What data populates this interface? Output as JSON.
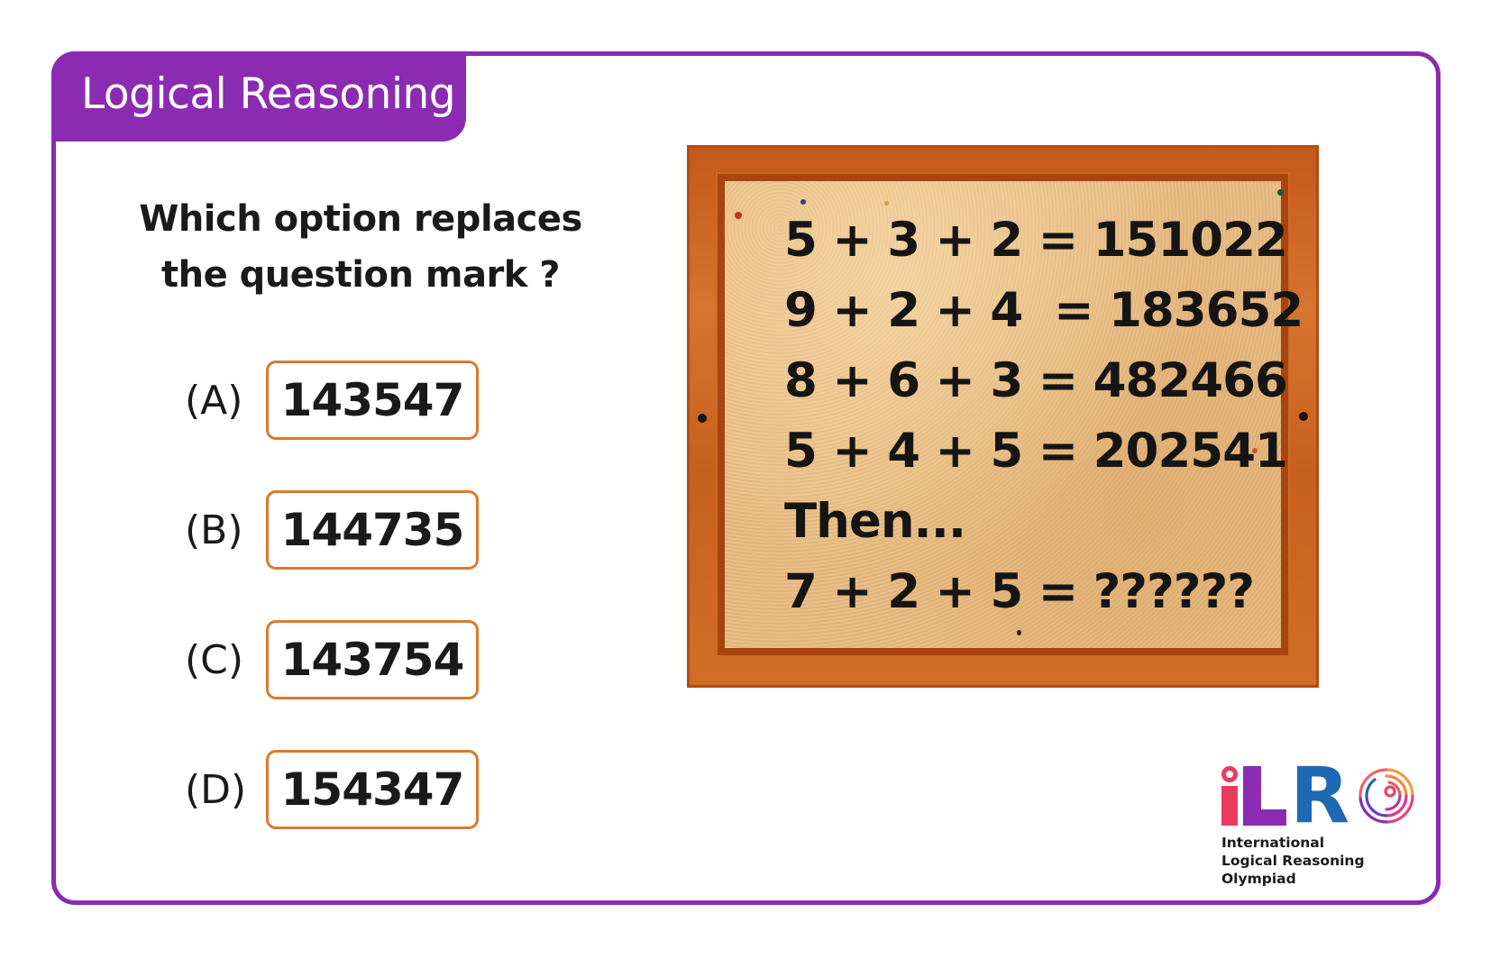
{
  "header": {
    "tab_label": "Logical Reasoning"
  },
  "question": {
    "line1": "Which option replaces",
    "line2": "the question mark ?"
  },
  "options": [
    {
      "letter": "(A)",
      "value": "143547"
    },
    {
      "letter": "(B)",
      "value": "144735"
    },
    {
      "letter": "(C)",
      "value": "143754"
    },
    {
      "letter": "(D)",
      "value": "154347"
    }
  ],
  "board": {
    "lines": [
      "5 + 3 + 2 = 151022",
      "9 + 2 + 4  = 183652",
      "8 + 6 + 3 = 482466",
      "5 + 4 + 5 = 202541",
      "Then...",
      "7 + 2 + 5 = ??????"
    ]
  },
  "logo": {
    "letters": [
      "i",
      "L",
      "R",
      "O"
    ],
    "name_lines": [
      "International",
      "Logical Reasoning",
      "Olympiad"
    ],
    "colors": {
      "i": "#ec3a5f",
      "L": "#8a2bb2",
      "R": "#1f68b4"
    }
  },
  "theme": {
    "accent": "#8a2bb2",
    "option_border": "#d97a2e"
  }
}
